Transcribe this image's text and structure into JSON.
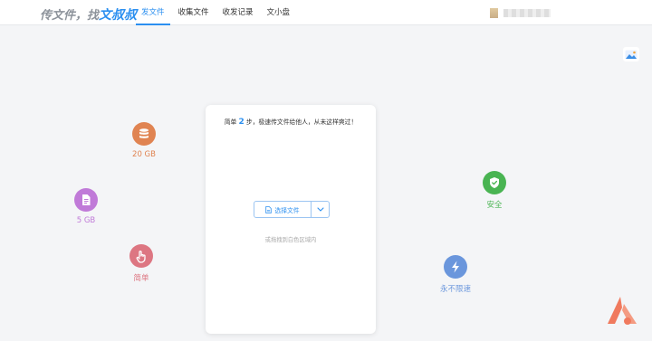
{
  "header": {
    "logo_prefix": "传文件，找",
    "logo_brand": "文叔叔",
    "nav": [
      "发文件",
      "收集文件",
      "收发记录",
      "文小盘"
    ]
  },
  "features": {
    "storage": {
      "label": "20 GB",
      "icon": "database-icon",
      "color": "#e08452"
    },
    "file_size": {
      "label": "5 GB",
      "icon": "document-icon",
      "color": "#c07ad8"
    },
    "simple": {
      "label": "简单",
      "icon": "hand-pointer-icon",
      "color": "#dd7682"
    },
    "secure": {
      "label": "安全",
      "icon": "shield-check-icon",
      "color": "#49b452"
    },
    "speed": {
      "label": "永不限速",
      "icon": "lightning-icon",
      "color": "#6a96dc"
    }
  },
  "card": {
    "tip_prefix": "简单",
    "tip_num": "2",
    "tip_suffix": "步，极速传文件给他人，从未这样爽过！",
    "select_label": "选择文件",
    "drop_hint": "或拖拽到白色区域内"
  },
  "colors": {
    "accent": "#2b8ff0",
    "corner_logo": "#f07a5e"
  }
}
